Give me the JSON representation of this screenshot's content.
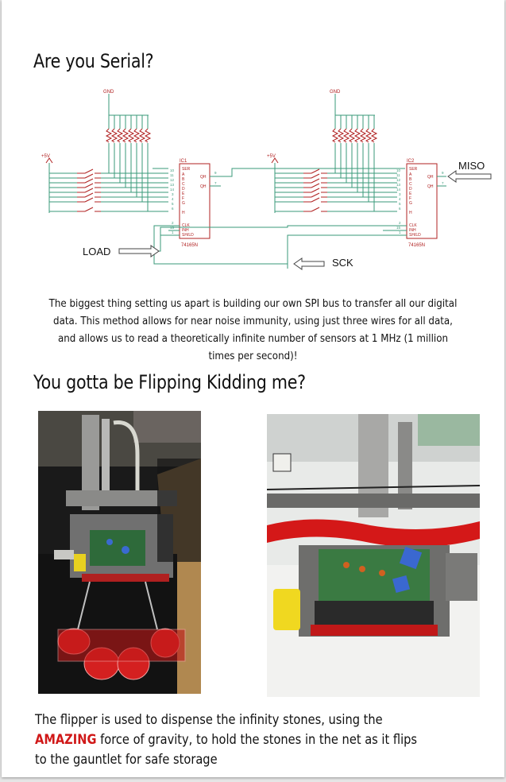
{
  "sections": {
    "serial": {
      "title": "Are you Serial?",
      "description": "The biggest thing setting us apart is building our own SPI bus to transfer all our digital data. This method allows for near noise immunity, using just three wires for all data, and allows us to read a theoretically infinite number of sensors at 1 MHz (1 million times per second)!"
    },
    "flipper": {
      "title": "You gotta be Flipping Kidding me?",
      "caption_before": "The flipper is used to dispense the infinity stones, using the ",
      "caption_highlight": "AMAZING",
      "caption_after": " force of gravity, to hold the stones in the net as it flips to the gauntlet for safe storage"
    }
  },
  "schematic": {
    "labels": {
      "miso": "MISO",
      "load": "LOAD",
      "sck": "SCK",
      "gnd": "GND",
      "vcc": "+5V",
      "chip1_name": "IC1",
      "chip2_name": "IC2",
      "chip_part": "74165N"
    },
    "chip_pins_left": [
      "SER",
      "A",
      "B",
      "C",
      "D",
      "E",
      "F",
      "G",
      "H"
    ],
    "chip_pins_left_bottom": [
      "CLK",
      "INH",
      "SH/LD"
    ],
    "chip_pins_right": [
      "QH",
      "QH"
    ],
    "pin_numbers_left": [
      "10",
      "11",
      "12",
      "13",
      "14",
      "3",
      "4",
      "5",
      "6"
    ],
    "pin_numbers_bottom": [
      "2",
      "15",
      "1"
    ],
    "pin_numbers_right": [
      "9",
      "7"
    ]
  },
  "colors": {
    "accent_red": "#d01818",
    "wire_green": "#3a9a7a",
    "chip_red": "#b02020"
  }
}
